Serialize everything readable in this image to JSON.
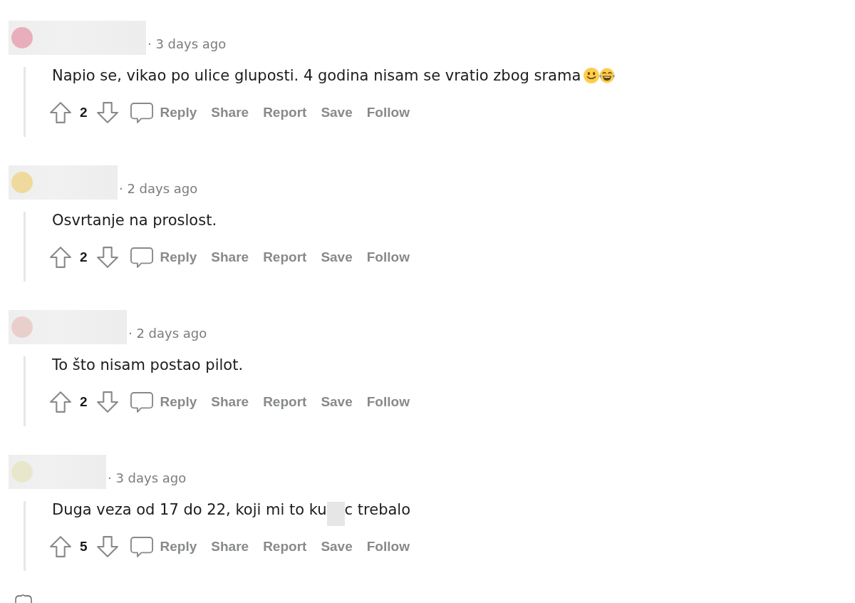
{
  "comments": [
    {
      "avatar": {
        "color": "#e9aebb"
      },
      "time": "· 3 days ago",
      "body": [
        {
          "kind": "text",
          "text": "Napio se, vikao po ulice gluposti. 4 godina nisam se vratio zbog srama"
        },
        {
          "kind": "smiley"
        },
        {
          "kind": "laughing"
        }
      ],
      "score": "2",
      "actions": [
        {
          "kind": "reply",
          "label": "Reply"
        },
        {
          "kind": "plain",
          "label": "Share"
        },
        {
          "kind": "plain",
          "label": "Report"
        },
        {
          "kind": "plain",
          "label": "Save"
        },
        {
          "kind": "plain",
          "label": "Follow"
        }
      ]
    },
    {
      "avatar": {
        "color": "#f0d99c"
      },
      "time": "· 2 days ago",
      "body": [
        {
          "kind": "text",
          "text": "Osvrtanje na proslost."
        }
      ],
      "score": "2",
      "actions": [
        {
          "kind": "reply",
          "label": "Reply"
        },
        {
          "kind": "plain",
          "label": "Share"
        },
        {
          "kind": "plain",
          "label": "Report"
        },
        {
          "kind": "plain",
          "label": "Save"
        },
        {
          "kind": "plain",
          "label": "Follow"
        }
      ]
    },
    {
      "avatar": {
        "color": "#e9cfcc"
      },
      "time": "· 2 days ago",
      "body": [
        {
          "kind": "text",
          "text": "To što nisam postao pilot."
        }
      ],
      "score": "2",
      "actions": [
        {
          "kind": "reply",
          "label": "Reply"
        },
        {
          "kind": "plain",
          "label": "Share"
        },
        {
          "kind": "plain",
          "label": "Report"
        },
        {
          "kind": "plain",
          "label": "Save"
        },
        {
          "kind": "plain",
          "label": "Follow"
        }
      ]
    },
    {
      "avatar": {
        "color": "#e8e7cb"
      },
      "time": "· 3 days ago",
      "body": [
        {
          "kind": "text",
          "text": "Duga veza od 17 do 22, koji mi to ku"
        },
        {
          "kind": "redacted"
        },
        {
          "kind": "text",
          "text": "c trebalo"
        }
      ],
      "score": "5",
      "actions": [
        {
          "kind": "reply",
          "label": "Reply"
        },
        {
          "kind": "plain",
          "label": "Share"
        },
        {
          "kind": "plain",
          "label": "Report"
        },
        {
          "kind": "plain",
          "label": "Save"
        },
        {
          "kind": "plain",
          "label": "Follow"
        }
      ]
    }
  ]
}
